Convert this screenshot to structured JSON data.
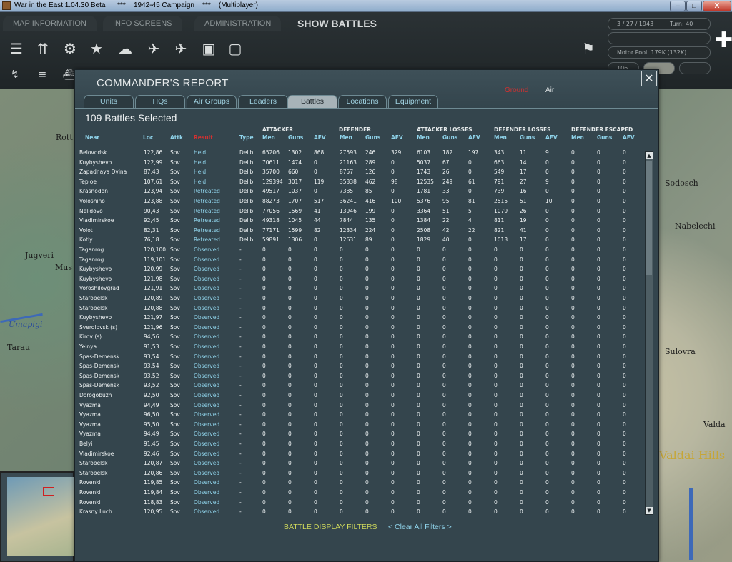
{
  "window": {
    "title": "War in the East 1.04.30 Beta      ***    1942-45 Campaign    ***    (Multiplayer)",
    "minimize": "–",
    "maximize": "□",
    "close": "X"
  },
  "topbar": {
    "tabs": [
      "MAP INFORMATION",
      "INFO SCREENS",
      "ADMINISTRATION",
      "SHOW BATTLES"
    ],
    "date": "3 / 27 / 1943",
    "turn": "Turn: 40",
    "motor_pool": "Motor Pool:  179K (132K)",
    "small_value": "106"
  },
  "map_labels": [
    "Rott",
    "Jugveri",
    "Mus",
    "Tarau",
    "Umapigi",
    "Nabelechi",
    "Sodosch",
    "Sulovra",
    "Valda",
    "Valdai Hills"
  ],
  "dialog": {
    "title": "COMMANDER'S REPORT",
    "mode_ground": "Ground",
    "mode_air": "Air",
    "close": "✕",
    "tabs": [
      "Units",
      "HQs",
      "Air Groups",
      "Leaders",
      "Battles",
      "Locations",
      "Equipment"
    ],
    "active_tab": "Battles",
    "count_text": "109 Battles Selected",
    "groups": {
      "attacker": "ATTACKER",
      "defender": "DEFENDER",
      "attacker_losses": "ATTACKER LOSSES",
      "defender_losses": "DEFENDER LOSSES",
      "defender_escaped": "DEFENDER ESCAPED"
    },
    "columns": {
      "near": "Near",
      "loc": "Loc",
      "attk": "Attk",
      "result": "Result",
      "type": "Type",
      "men": "Men",
      "guns": "Guns",
      "afv": "AFV"
    },
    "filters_label": "BATTLE DISPLAY FILTERS",
    "clear_label": "< Clear All Filters >"
  },
  "rows": [
    [
      "Belovodsk",
      "122,86",
      "Sov",
      "Held",
      "Delib",
      "65206",
      "1302",
      "868",
      "27593",
      "246",
      "329",
      "6103",
      "182",
      "197",
      "343",
      "11",
      "9",
      "0",
      "0",
      "0"
    ],
    [
      "Kuybyshevo",
      "122,99",
      "Sov",
      "Held",
      "Delib",
      "70611",
      "1474",
      "0",
      "21163",
      "289",
      "0",
      "5037",
      "67",
      "0",
      "663",
      "14",
      "0",
      "0",
      "0",
      "0"
    ],
    [
      "Zapadnaya Dvina",
      "87,43",
      "Sov",
      "Held",
      "Delib",
      "35700",
      "660",
      "0",
      "8757",
      "126",
      "0",
      "1743",
      "26",
      "0",
      "549",
      "17",
      "0",
      "0",
      "0",
      "0"
    ],
    [
      "Teploe",
      "107,61",
      "Sov",
      "Held",
      "Delib",
      "129394",
      "3017",
      "119",
      "35338",
      "462",
      "98",
      "12535",
      "249",
      "61",
      "791",
      "27",
      "9",
      "0",
      "0",
      "0"
    ],
    [
      "Krasnodon",
      "123,94",
      "Sov",
      "Retreated",
      "Delib",
      "49517",
      "1037",
      "0",
      "7385",
      "85",
      "0",
      "1781",
      "33",
      "0",
      "739",
      "16",
      "0",
      "0",
      "0",
      "0"
    ],
    [
      "Voloshino",
      "123,88",
      "Sov",
      "Retreated",
      "Delib",
      "88273",
      "1707",
      "517",
      "36241",
      "416",
      "100",
      "5376",
      "95",
      "81",
      "2515",
      "51",
      "10",
      "0",
      "0",
      "0"
    ],
    [
      "Nelidovo",
      "90,43",
      "Sov",
      "Retreated",
      "Delib",
      "77056",
      "1569",
      "41",
      "13946",
      "199",
      "0",
      "3364",
      "51",
      "5",
      "1079",
      "26",
      "0",
      "0",
      "0",
      "0"
    ],
    [
      "Vladimirskoe",
      "92,45",
      "Sov",
      "Retreated",
      "Delib",
      "49318",
      "1045",
      "44",
      "7844",
      "135",
      "0",
      "1384",
      "22",
      "4",
      "811",
      "19",
      "0",
      "0",
      "0",
      "0"
    ],
    [
      "Volot",
      "82,31",
      "Sov",
      "Retreated",
      "Delib",
      "77171",
      "1599",
      "82",
      "12334",
      "224",
      "0",
      "2508",
      "42",
      "22",
      "821",
      "41",
      "0",
      "0",
      "0",
      "0"
    ],
    [
      "Kotly",
      "76,18",
      "Sov",
      "Retreated",
      "Delib",
      "59891",
      "1306",
      "0",
      "12631",
      "89",
      "0",
      "1829",
      "40",
      "0",
      "1013",
      "17",
      "0",
      "0",
      "0",
      "0"
    ],
    [
      "Taganrog",
      "120,100",
      "Sov",
      "Observed",
      "-",
      "0",
      "0",
      "0",
      "0",
      "0",
      "0",
      "0",
      "0",
      "0",
      "0",
      "0",
      "0",
      "0",
      "0",
      "0"
    ],
    [
      "Taganrog",
      "119,101",
      "Sov",
      "Observed",
      "-",
      "0",
      "0",
      "0",
      "0",
      "0",
      "0",
      "0",
      "0",
      "0",
      "0",
      "0",
      "0",
      "0",
      "0",
      "0"
    ],
    [
      "Kuybyshevo",
      "120,99",
      "Sov",
      "Observed",
      "-",
      "0",
      "0",
      "0",
      "0",
      "0",
      "0",
      "0",
      "0",
      "0",
      "0",
      "0",
      "0",
      "0",
      "0",
      "0"
    ],
    [
      "Kuybyshevo",
      "121,98",
      "Sov",
      "Observed",
      "-",
      "0",
      "0",
      "0",
      "0",
      "0",
      "0",
      "0",
      "0",
      "0",
      "0",
      "0",
      "0",
      "0",
      "0",
      "0"
    ],
    [
      "Voroshilovgrad",
      "121,91",
      "Sov",
      "Observed",
      "-",
      "0",
      "0",
      "0",
      "0",
      "0",
      "0",
      "0",
      "0",
      "0",
      "0",
      "0",
      "0",
      "0",
      "0",
      "0"
    ],
    [
      "Starobelsk",
      "120,89",
      "Sov",
      "Observed",
      "-",
      "0",
      "0",
      "0",
      "0",
      "0",
      "0",
      "0",
      "0",
      "0",
      "0",
      "0",
      "0",
      "0",
      "0",
      "0"
    ],
    [
      "Starobelsk",
      "120,88",
      "Sov",
      "Observed",
      "-",
      "0",
      "0",
      "0",
      "0",
      "0",
      "0",
      "0",
      "0",
      "0",
      "0",
      "0",
      "0",
      "0",
      "0",
      "0"
    ],
    [
      "Kuybyshevo",
      "121,97",
      "Sov",
      "Observed",
      "-",
      "0",
      "0",
      "0",
      "0",
      "0",
      "0",
      "0",
      "0",
      "0",
      "0",
      "0",
      "0",
      "0",
      "0",
      "0"
    ],
    [
      "Sverdlovsk (s)",
      "121,96",
      "Sov",
      "Observed",
      "-",
      "0",
      "0",
      "0",
      "0",
      "0",
      "0",
      "0",
      "0",
      "0",
      "0",
      "0",
      "0",
      "0",
      "0",
      "0"
    ],
    [
      "Kirov (s)",
      "94,56",
      "Sov",
      "Observed",
      "-",
      "0",
      "0",
      "0",
      "0",
      "0",
      "0",
      "0",
      "0",
      "0",
      "0",
      "0",
      "0",
      "0",
      "0",
      "0"
    ],
    [
      "Yelnya",
      "91,53",
      "Sov",
      "Observed",
      "-",
      "0",
      "0",
      "0",
      "0",
      "0",
      "0",
      "0",
      "0",
      "0",
      "0",
      "0",
      "0",
      "0",
      "0",
      "0"
    ],
    [
      "Spas-Demensk",
      "93,54",
      "Sov",
      "Observed",
      "-",
      "0",
      "0",
      "0",
      "0",
      "0",
      "0",
      "0",
      "0",
      "0",
      "0",
      "0",
      "0",
      "0",
      "0",
      "0"
    ],
    [
      "Spas-Demensk",
      "93,54",
      "Sov",
      "Observed",
      "-",
      "0",
      "0",
      "0",
      "0",
      "0",
      "0",
      "0",
      "0",
      "0",
      "0",
      "0",
      "0",
      "0",
      "0",
      "0"
    ],
    [
      "Spas-Demensk",
      "93,52",
      "Sov",
      "Observed",
      "-",
      "0",
      "0",
      "0",
      "0",
      "0",
      "0",
      "0",
      "0",
      "0",
      "0",
      "0",
      "0",
      "0",
      "0",
      "0"
    ],
    [
      "Spas-Demensk",
      "93,52",
      "Sov",
      "Observed",
      "-",
      "0",
      "0",
      "0",
      "0",
      "0",
      "0",
      "0",
      "0",
      "0",
      "0",
      "0",
      "0",
      "0",
      "0",
      "0"
    ],
    [
      "Dorogobuzh",
      "92,50",
      "Sov",
      "Observed",
      "-",
      "0",
      "0",
      "0",
      "0",
      "0",
      "0",
      "0",
      "0",
      "0",
      "0",
      "0",
      "0",
      "0",
      "0",
      "0"
    ],
    [
      "Vyazma",
      "94,49",
      "Sov",
      "Observed",
      "-",
      "0",
      "0",
      "0",
      "0",
      "0",
      "0",
      "0",
      "0",
      "0",
      "0",
      "0",
      "0",
      "0",
      "0",
      "0"
    ],
    [
      "Vyazma",
      "96,50",
      "Sov",
      "Observed",
      "-",
      "0",
      "0",
      "0",
      "0",
      "0",
      "0",
      "0",
      "0",
      "0",
      "0",
      "0",
      "0",
      "0",
      "0",
      "0"
    ],
    [
      "Vyazma",
      "95,50",
      "Sov",
      "Observed",
      "-",
      "0",
      "0",
      "0",
      "0",
      "0",
      "0",
      "0",
      "0",
      "0",
      "0",
      "0",
      "0",
      "0",
      "0",
      "0"
    ],
    [
      "Vyazma",
      "94,49",
      "Sov",
      "Observed",
      "-",
      "0",
      "0",
      "0",
      "0",
      "0",
      "0",
      "0",
      "0",
      "0",
      "0",
      "0",
      "0",
      "0",
      "0",
      "0"
    ],
    [
      "Belyi",
      "91,45",
      "Sov",
      "Observed",
      "-",
      "0",
      "0",
      "0",
      "0",
      "0",
      "0",
      "0",
      "0",
      "0",
      "0",
      "0",
      "0",
      "0",
      "0",
      "0"
    ],
    [
      "Vladimirskoe",
      "92,46",
      "Sov",
      "Observed",
      "-",
      "0",
      "0",
      "0",
      "0",
      "0",
      "0",
      "0",
      "0",
      "0",
      "0",
      "0",
      "0",
      "0",
      "0",
      "0"
    ],
    [
      "Starobelsk",
      "120,87",
      "Sov",
      "Observed",
      "-",
      "0",
      "0",
      "0",
      "0",
      "0",
      "0",
      "0",
      "0",
      "0",
      "0",
      "0",
      "0",
      "0",
      "0",
      "0"
    ],
    [
      "Starobelsk",
      "120,86",
      "Sov",
      "Observed",
      "-",
      "0",
      "0",
      "0",
      "0",
      "0",
      "0",
      "0",
      "0",
      "0",
      "0",
      "0",
      "0",
      "0",
      "0",
      "0"
    ],
    [
      "Rovenki",
      "119,85",
      "Sov",
      "Observed",
      "-",
      "0",
      "0",
      "0",
      "0",
      "0",
      "0",
      "0",
      "0",
      "0",
      "0",
      "0",
      "0",
      "0",
      "0",
      "0"
    ],
    [
      "Rovenki",
      "119,84",
      "Sov",
      "Observed",
      "-",
      "0",
      "0",
      "0",
      "0",
      "0",
      "0",
      "0",
      "0",
      "0",
      "0",
      "0",
      "0",
      "0",
      "0",
      "0"
    ],
    [
      "Rovenki",
      "118,83",
      "Sov",
      "Observed",
      "-",
      "0",
      "0",
      "0",
      "0",
      "0",
      "0",
      "0",
      "0",
      "0",
      "0",
      "0",
      "0",
      "0",
      "0",
      "0"
    ],
    [
      "Krasny Luch",
      "120,95",
      "Sov",
      "Observed",
      "-",
      "0",
      "0",
      "0",
      "0",
      "0",
      "0",
      "0",
      "0",
      "0",
      "0",
      "0",
      "0",
      "0",
      "0",
      "0"
    ]
  ]
}
